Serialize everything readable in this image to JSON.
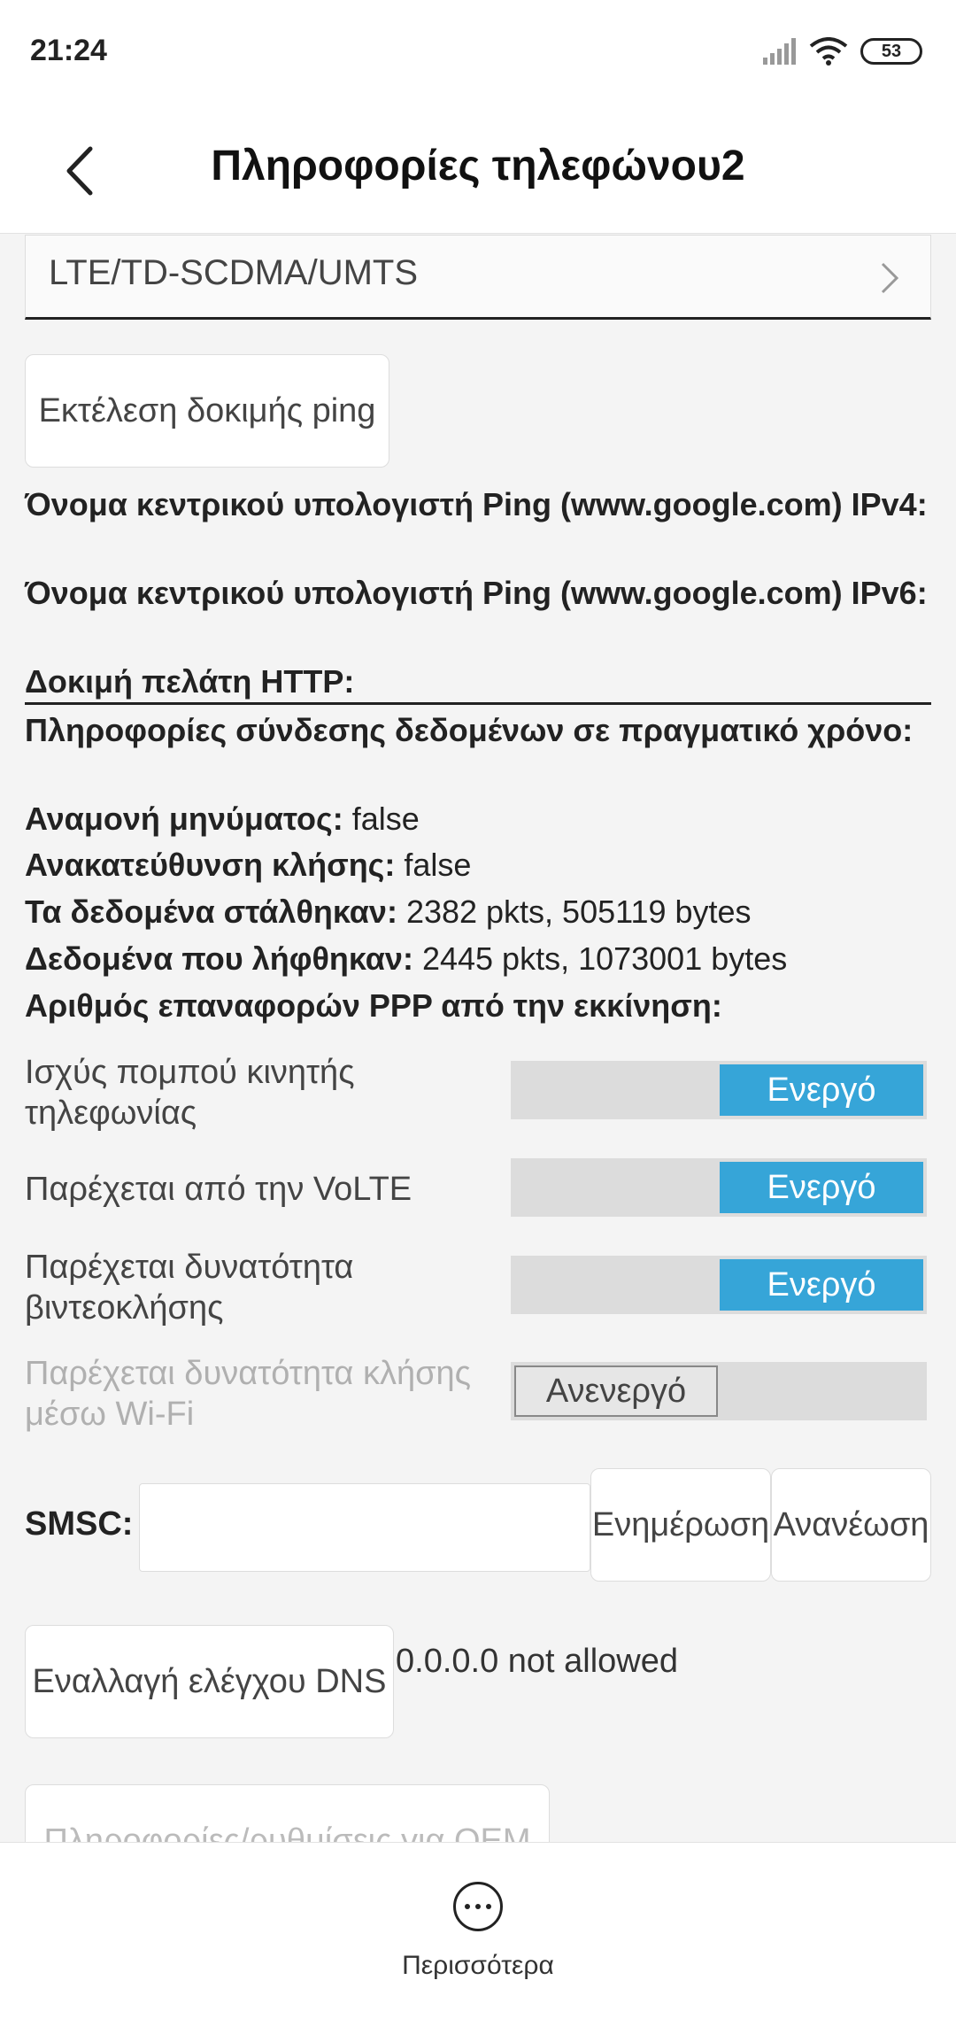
{
  "status_bar": {
    "time": "21:24",
    "battery": "53"
  },
  "header": {
    "title": "Πληροφορίες τηλεφώνου2"
  },
  "network_type": {
    "value": "LTE/TD-SCDMA/UMTS"
  },
  "ping_button": "Εκτέλεση δοκιμής ping",
  "info": {
    "ping_ipv4_label": "Όνομα κεντρικού υπολογιστή Ping (www.google.com) IPv4:",
    "ping_ipv6_label": "Όνομα κεντρικού υπολογιστή Ping (www.google.com) IPv6:",
    "http_client_label": "Δοκιμή πελάτη HTTP:",
    "realtime_label": "Πληροφορίες σύνδεσης δεδομένων σε πραγματικό χρόνο:",
    "message_waiting_label": "Αναμονή μηνύματος:",
    "message_waiting_value": " false",
    "call_redirect_label": "Ανακατεύθυνση κλήσης:",
    "call_redirect_value": " false",
    "data_sent_label": "Τα δεδομένα στάλθηκαν:",
    "data_sent_value": " 2382 pkts, 505119 bytes",
    "data_received_label": "Δεδομένα που λήφθηκαν:",
    "data_received_value": " 2445 pkts, 1073001 bytes",
    "ppp_reset_label": "Αριθμός επαναφορών PPP από την εκκίνηση:"
  },
  "toggles": [
    {
      "label": "Ισχύς πομπού κινητής τηλεφωνίας",
      "state": "Ενεργό"
    },
    {
      "label": "Παρέχεται από την VoLTE",
      "state": "Ενεργό"
    },
    {
      "label": "Παρέχεται δυνατότητα βιντεοκλήσης",
      "state": "Ενεργό"
    },
    {
      "label": "Παρέχεται δυνατότητα κλήσης μέσω Wi-Fi",
      "state": "Ανενεργό"
    }
  ],
  "smsc": {
    "label": "SMSC:",
    "value": "",
    "update_button": "Ενημέρωση",
    "refresh_button": "Ανανέωση"
  },
  "dns": {
    "button": "Εναλλαγή ελέγχου DNS",
    "status": "0.0.0.0 not allowed"
  },
  "oem_button": "Πληροφορίες/ρυθμίσεις για OEM",
  "bottom_bar": {
    "more_label": "Περισσότερα"
  },
  "colors": {
    "accent": "#36a5d8",
    "background": "#f4f4f4"
  }
}
